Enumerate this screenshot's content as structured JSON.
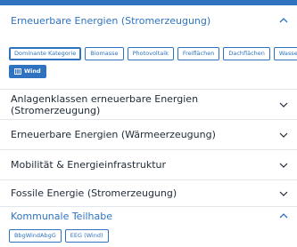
{
  "colors": {
    "accent": "#2f73c0",
    "text": "#1f2a36",
    "divider": "#e3e7ec"
  },
  "sections": [
    {
      "title": "Erneuerbare Energien (Stromerzeugung)",
      "expanded": true,
      "chips_row1": [
        "Dominante Kategorie",
        "Biomasse",
        "Photovoltaik",
        "Freiflächen",
        "Dachflächen",
        "Wasserkraft"
      ],
      "chips_row2": [
        {
          "label": "Wind",
          "icon": "grid-icon",
          "active": true
        }
      ]
    },
    {
      "title": "Anlagenklassen erneuerbare Energien (Stromerzeugung)",
      "expanded": false
    },
    {
      "title": "Erneuerbare Energien (Wärmeerzeugung)",
      "expanded": false
    },
    {
      "title": "Mobilität & Energieinfrastruktur",
      "expanded": false
    },
    {
      "title": "Fossile Energie (Stromerzeugung)",
      "expanded": false
    },
    {
      "title": "Kommunale Teilhabe",
      "expanded": true,
      "chips_row1": [
        "BbgWindAbgG",
        "EEG (Wind)"
      ]
    }
  ]
}
